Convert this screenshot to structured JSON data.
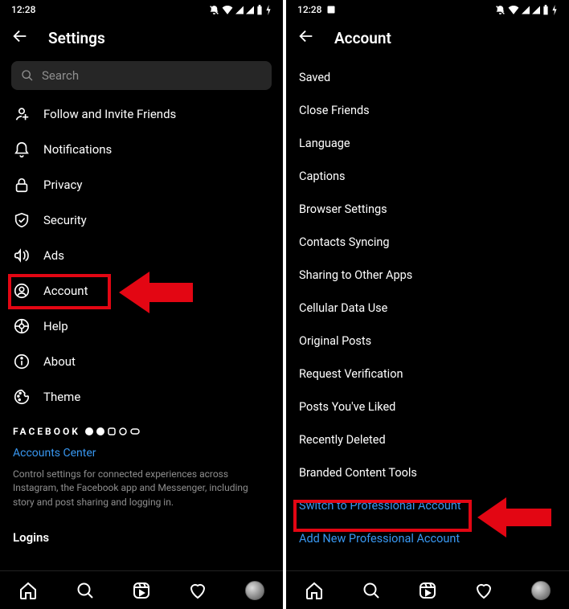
{
  "status": {
    "time": "12:28",
    "icons": [
      "dnd",
      "wifi",
      "signal1",
      "signal2",
      "battery",
      "bolt"
    ]
  },
  "left": {
    "title": "Settings",
    "search_placeholder": "Search",
    "items": [
      {
        "icon": "invite",
        "label": "Follow and Invite Friends"
      },
      {
        "icon": "bell",
        "label": "Notifications"
      },
      {
        "icon": "lock",
        "label": "Privacy"
      },
      {
        "icon": "shield",
        "label": "Security"
      },
      {
        "icon": "mega",
        "label": "Ads"
      },
      {
        "icon": "account",
        "label": "Account"
      },
      {
        "icon": "help",
        "label": "Help"
      },
      {
        "icon": "info",
        "label": "About"
      },
      {
        "icon": "theme",
        "label": "Theme"
      }
    ],
    "facebook_label": "FACEBOOK",
    "accounts_center": "Accounts Center",
    "accounts_desc": "Control settings for connected experiences across Instagram, the Facebook app and Messenger, including story and post sharing and logging in.",
    "logins": "Logins"
  },
  "right": {
    "title": "Account",
    "items": [
      {
        "label": "Saved"
      },
      {
        "label": "Close Friends"
      },
      {
        "label": "Language"
      },
      {
        "label": "Captions"
      },
      {
        "label": "Browser Settings"
      },
      {
        "label": "Contacts Syncing"
      },
      {
        "label": "Sharing to Other Apps"
      },
      {
        "label": "Cellular Data Use"
      },
      {
        "label": "Original Posts"
      },
      {
        "label": "Request Verification"
      },
      {
        "label": "Posts You've Liked"
      },
      {
        "label": "Recently Deleted"
      },
      {
        "label": "Branded Content Tools"
      },
      {
        "label": "Switch to Professional Account",
        "blue": true
      },
      {
        "label": "Add New Professional Account",
        "blue": true
      }
    ]
  }
}
